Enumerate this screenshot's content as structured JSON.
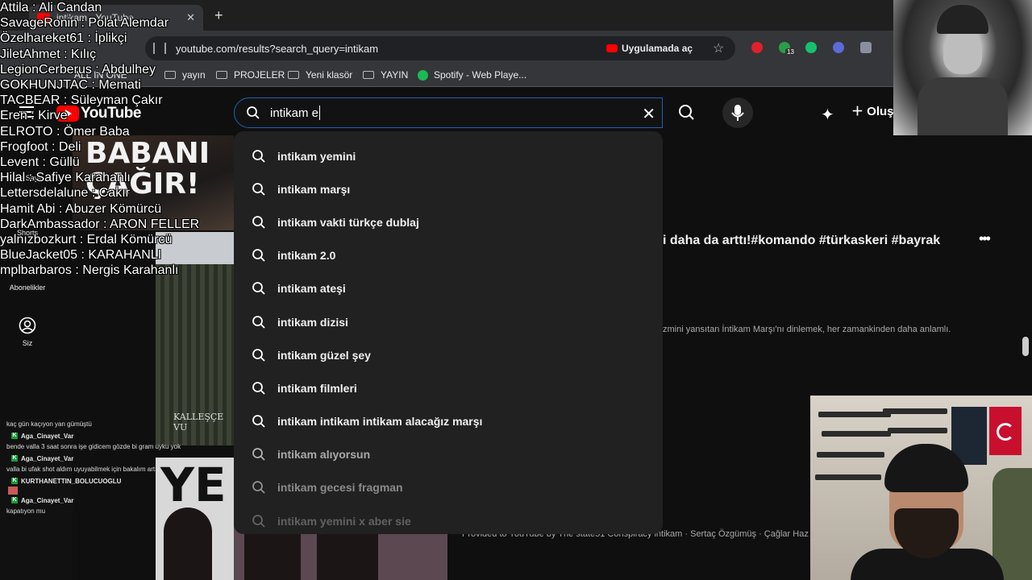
{
  "browser": {
    "tab_title": "intikam - YouTube",
    "url": "youtube.com/results?search_query=intikam",
    "open_in_app": "Uygulamada aç",
    "extension_badge": "13",
    "bookmarks": [
      {
        "label": "ALL IN ONE",
        "type": "text"
      },
      {
        "label": "yayın",
        "type": "folder"
      },
      {
        "label": "PROJELER",
        "type": "folder"
      },
      {
        "label": "Yeni klasör",
        "type": "folder"
      },
      {
        "label": "YAYIN",
        "type": "folder"
      },
      {
        "label": "Spotify - Web Playe...",
        "type": "spotify"
      }
    ]
  },
  "youtube": {
    "logo": "YouTube",
    "search_value": "intikam e",
    "create_label": "Oluş",
    "sidebar": [
      {
        "label": "Ana Sayfa"
      },
      {
        "label": "Shorts"
      },
      {
        "label": "Abonelikler"
      },
      {
        "label": "Siz"
      }
    ],
    "suggestions": [
      "intikam yemini",
      "intikam marşı",
      "intikam vakti türkçe dublaj",
      "intikam 2.0",
      "intikam ateşi",
      "intikam dizisi",
      "intikam güzel şey",
      "intikam filmleri",
      "intikam intikam intikam alacağız marşı",
      "intikam alıyorsun",
      "intikam gecesi fragman",
      "intikam yemini x aber sie"
    ],
    "result_title_fragment": "i daha da arttı!#komando #türkaskeri #bayrak",
    "result_desc_fragment": "zmini yansıtan İntikam Marşı'nı dinlemek, her zamankinden daha anlamlı.",
    "provided_line": "Provided to YouTube by The state51 Conspiracy intikam · Sertaç Özgümüş · Çağlar Haz",
    "thumb_text_1": "BABANI",
    "thumb_text_2": "ÇAĞIR!",
    "thumb_caption": "KALLEŞÇE VU",
    "thumb_text_3": "YE"
  },
  "overlay_names": [
    "Attila : Ali Candan",
    "SavageRonin : Polat Alemdar",
    "Özelhareket61 : İplikçi",
    "JiletAhmet : Kılıç",
    "LegionCerberus : Abdulhey",
    "GOKHUNJTAC : Memati",
    "TACBEAR : Süleyman Çakır",
    "Eren : Kirve",
    "ELROTO : Ömer Baba",
    "Frogfoot : Deli",
    "Levent : Güllü",
    "Hilal : Safiye Karahanlı",
    "Lettersdelalune : Cakır",
    "Hamit Abi : Abuzer Kömürcü",
    "DarkAmbassador : ARON FELLER",
    "yalnızbozkurt : Erdal Kömürcü",
    "BlueJacket05 : KARAHANLI",
    "mplbarbaros : Nergis Karahanlı"
  ],
  "chat": [
    {
      "type": "msg",
      "text": "kaç gün kaçıyon yan gümüştü"
    },
    {
      "type": "user",
      "name": "Aga_Cinayet_Var"
    },
    {
      "type": "msg",
      "text": "bende valla 3 saat sonra işe gidicem gözde bi gram uyku yok"
    },
    {
      "type": "user",
      "name": "Aga_Cinayet_Var"
    },
    {
      "type": "msg",
      "text": "valla bi ufak shot aldım uyuyabilmek için bakalım artık"
    },
    {
      "type": "user",
      "name": "KURTHANETTIN_BOLUCUOGLU"
    },
    {
      "type": "emote"
    },
    {
      "type": "user",
      "name": "Aga_Cinayet_Var"
    },
    {
      "type": "msg",
      "text": "kapatıyon mu"
    }
  ]
}
